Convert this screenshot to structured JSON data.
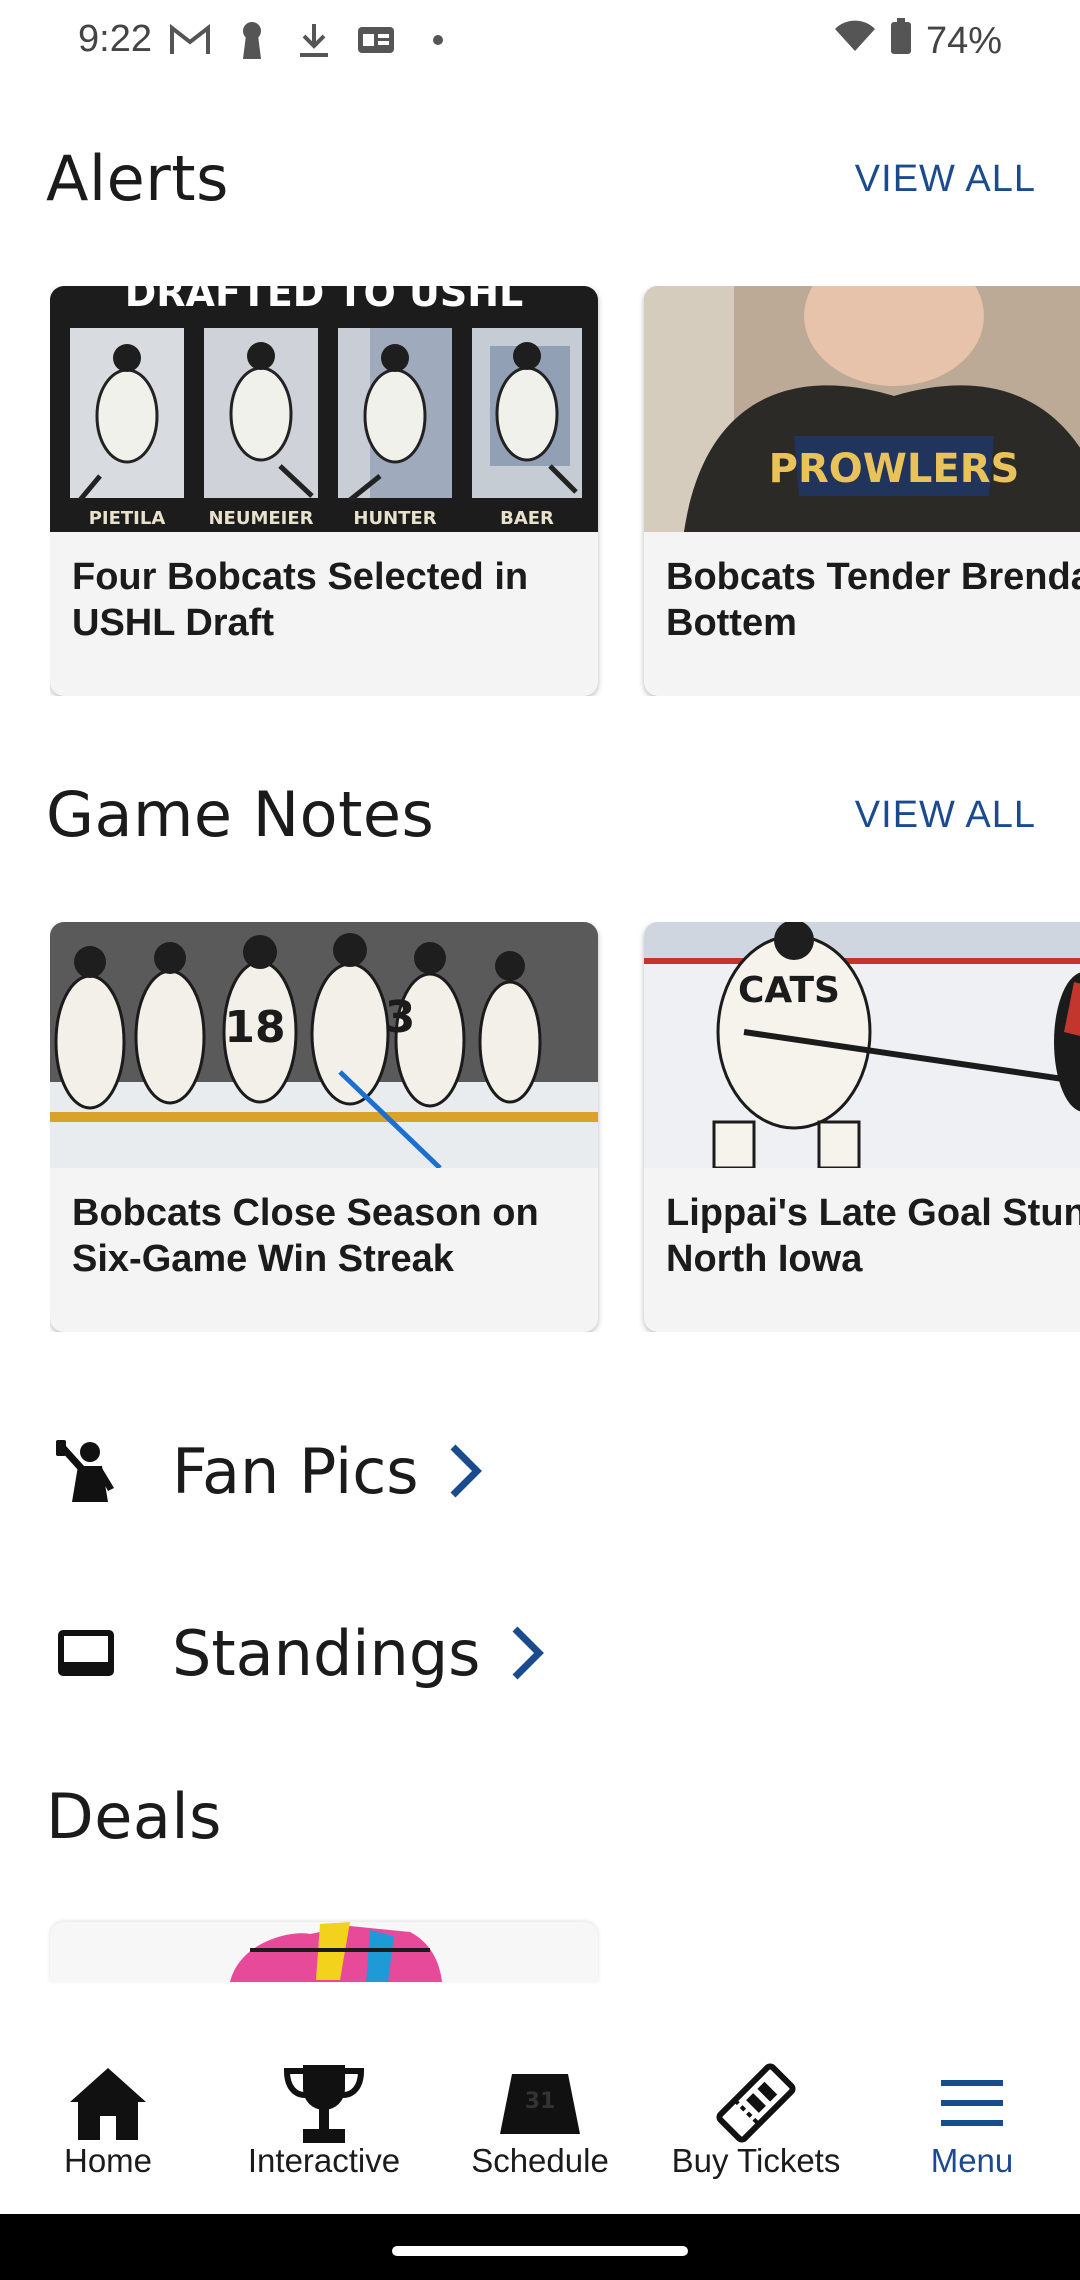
{
  "status_bar": {
    "time": "9:22",
    "battery": "74%"
  },
  "alerts": {
    "title": "Alerts",
    "view_all": "VIEW ALL",
    "cards": [
      {
        "banner": "DRAFTED TO USHL",
        "names": [
          "PIETILA",
          "NEUMEIER",
          "HUNTER",
          "BAER"
        ],
        "title": "Four Bobcats Selected in\nUSHL Draft"
      },
      {
        "hoodie_text": "PROWLERS",
        "title": "Bobcats Tender Brendan\nBottem"
      }
    ]
  },
  "game_notes": {
    "title": "Game Notes",
    "view_all": "VIEW ALL",
    "cards": [
      {
        "title": "Bobcats Close Season on\nSix-Game Win Streak"
      },
      {
        "title": "Lippai's Late Goal Stuns\nNorth Iowa"
      }
    ]
  },
  "links": {
    "fan_pics": "Fan Pics",
    "standings": "Standings"
  },
  "deals": {
    "title": "Deals"
  },
  "bottom_nav": {
    "items": [
      {
        "label": "Home",
        "icon": "home-icon"
      },
      {
        "label": "Interactive",
        "icon": "trophy-icon"
      },
      {
        "label": "Schedule",
        "icon": "calendar-icon"
      },
      {
        "label": "Buy Tickets",
        "icon": "ticket-icon"
      },
      {
        "label": "Menu",
        "icon": "menu-icon"
      }
    ]
  },
  "colors": {
    "accent": "#1a4b8f",
    "text": "#1b1b1b",
    "card_bg": "#f4f4f4"
  }
}
